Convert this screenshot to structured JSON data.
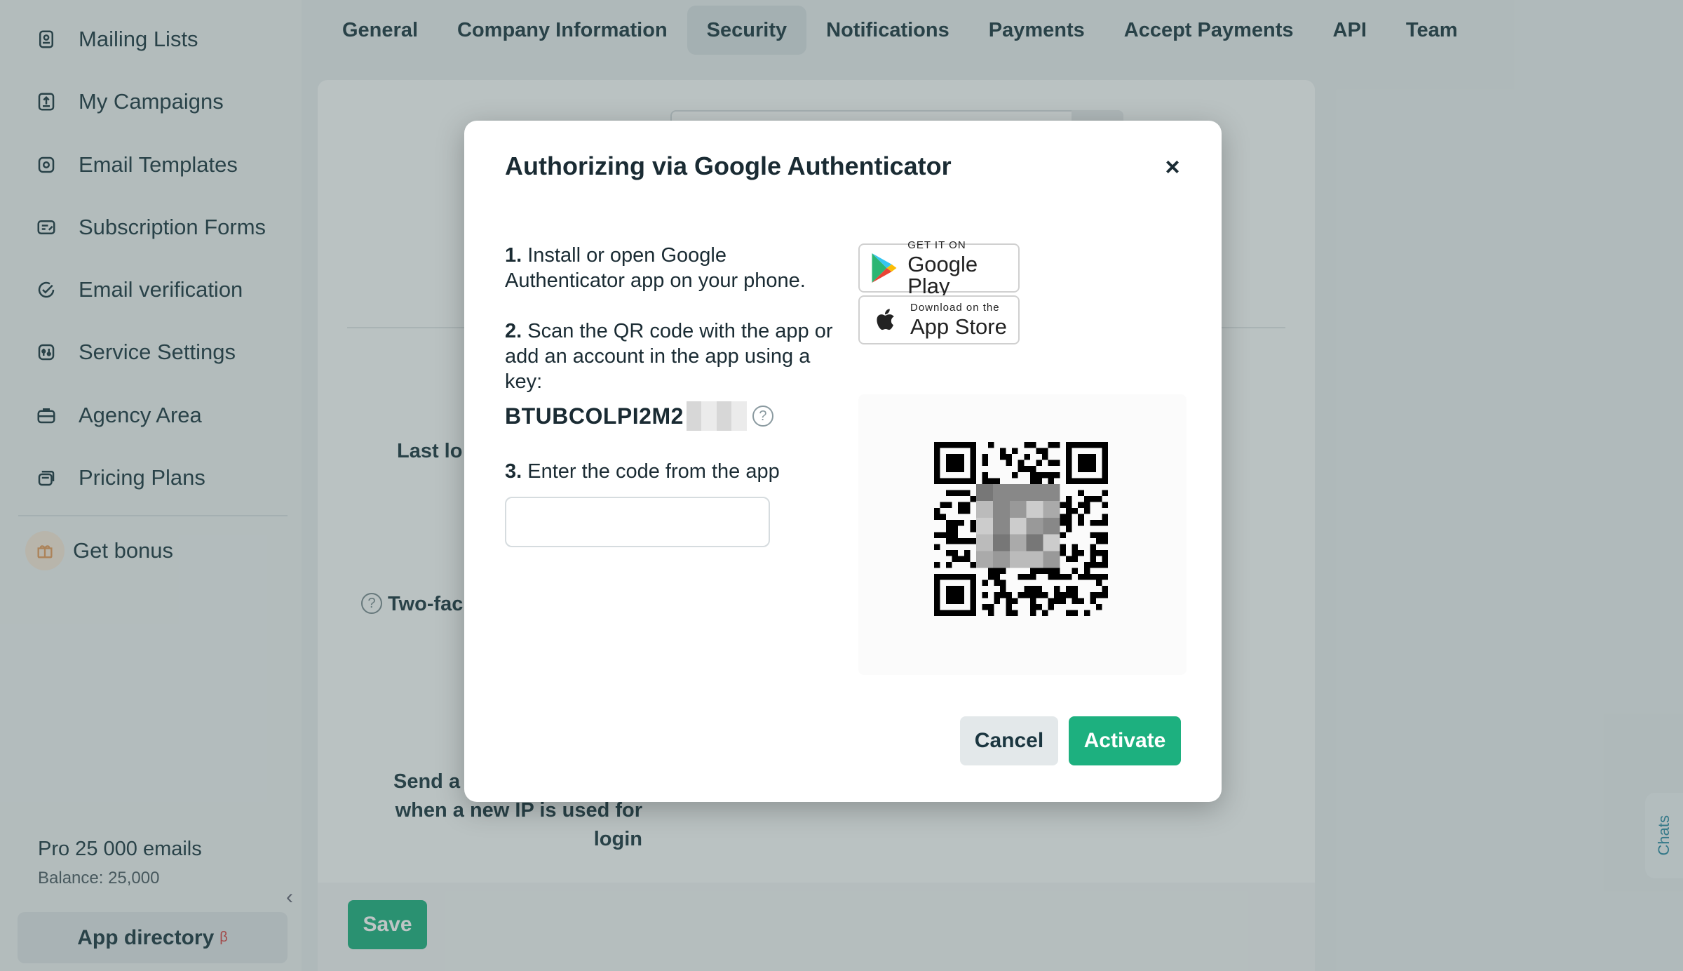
{
  "sidebar": {
    "items": [
      {
        "label": "Mailing Lists",
        "icon": "list-icon"
      },
      {
        "label": "My Campaigns",
        "icon": "campaign-icon"
      },
      {
        "label": "Email Templates",
        "icon": "template-icon"
      },
      {
        "label": "Subscription Forms",
        "icon": "form-icon"
      },
      {
        "label": "Email verification",
        "icon": "check-icon"
      },
      {
        "label": "Service Settings",
        "icon": "settings-icon"
      },
      {
        "label": "Agency Area",
        "icon": "briefcase-icon"
      },
      {
        "label": "Pricing Plans",
        "icon": "pricing-icon"
      }
    ],
    "bonus_label": "Get bonus",
    "plan": "Pro 25 000 emails",
    "balance": "Balance: 25,000",
    "app_directory": "App directory",
    "app_directory_sup": "β"
  },
  "tabs": [
    "General",
    "Company Information",
    "Security",
    "Notifications",
    "Payments",
    "Accept Payments",
    "API",
    "Team"
  ],
  "active_tab": "Security",
  "background": {
    "last_login_label": "Last lo",
    "two_factor_label": "Two-fac",
    "send_alert_line1": "Send a",
    "send_alert_line2": "when a new IP is used for",
    "send_alert_line3": "login",
    "save_label": "Save"
  },
  "chats_label": "Chats",
  "modal": {
    "title": "Authorizing via Google Authenticator",
    "close": "×",
    "step1_num": "1.",
    "step1_text": "Install or open Google Authenticator app on your phone.",
    "step2_num": "2.",
    "step2_text": "Scan the QR code with the app or add an account in the app using a key:",
    "key": "BTUBCOLPI2M2",
    "help": "?",
    "step3_num": "3.",
    "step3_text": "Enter the code from the app",
    "code_value": "",
    "google_play_small": "GET IT ON",
    "google_play_big": "Google Play",
    "app_store_small": "Download on the",
    "app_store_big": "App Store",
    "cancel": "Cancel",
    "activate": "Activate"
  },
  "colors": {
    "accent": "#1db07f",
    "active_tab": "#d8dfe2",
    "overlay": "rgba(70,90,90,0.35)"
  }
}
